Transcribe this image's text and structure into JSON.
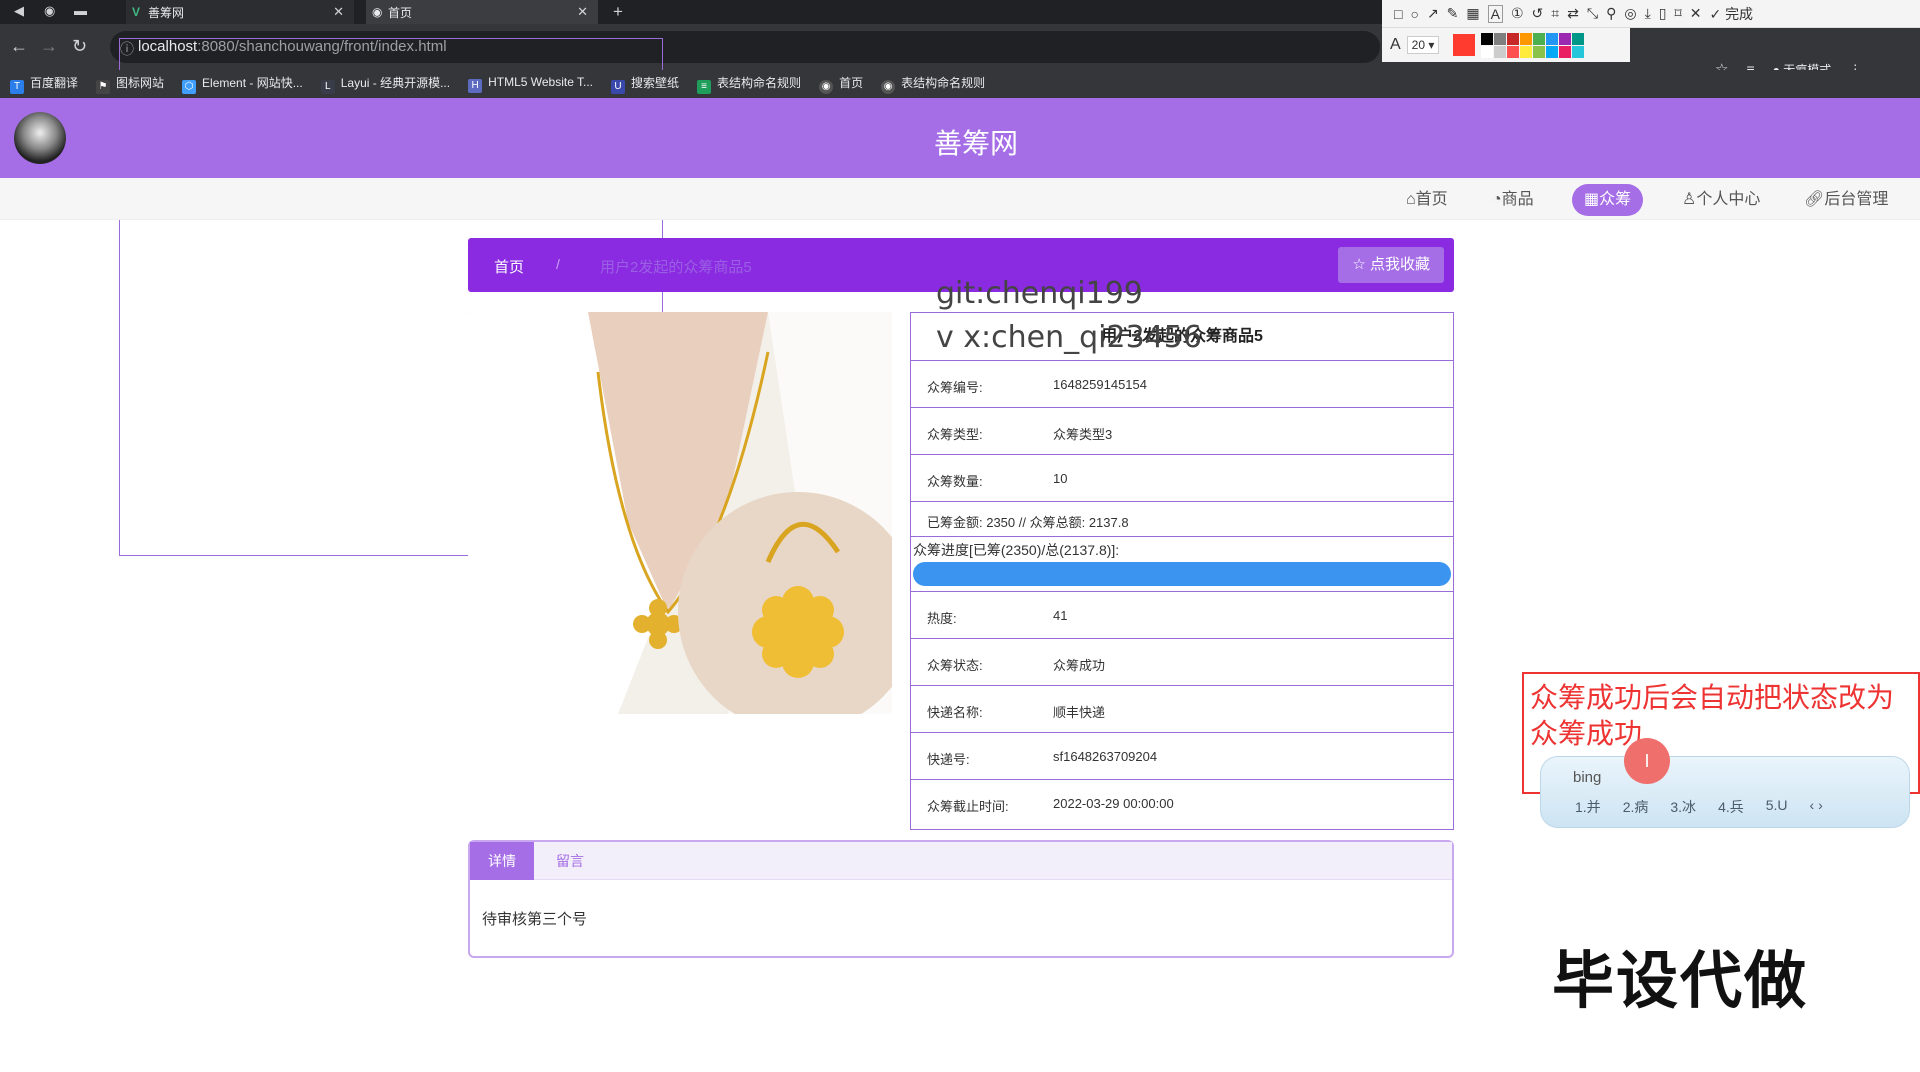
{
  "browser": {
    "tabs": [
      {
        "label": "善筹网"
      },
      {
        "label": "首页"
      }
    ],
    "url_host": "localhost",
    "url_path": ":8080/shanchouwang/front/index.html",
    "incognito_label": "无痕模式",
    "bookmarks": [
      "百度翻译",
      "图标网站",
      "Element - 网站快...",
      "Layui - 经典开源模...",
      "HTML5 Website T...",
      "搜索壁纸",
      "表结构命名规则",
      "首页",
      "表结构命名规则"
    ]
  },
  "annotation_toolbar": {
    "font_size": "20",
    "done_label": "完成",
    "colors": [
      "#ff3b30",
      "#000000",
      "#7f7f7f",
      "#c62828",
      "#ff9800",
      "#4caf50",
      "#2196f3",
      "#9c27b0",
      "#009688",
      "#ffffff",
      "#cccccc",
      "#ff4f4f",
      "#ffeb3b",
      "#8bc34a",
      "#03a9f4",
      "#e91e63",
      "#26c6da"
    ]
  },
  "site": {
    "title": "善筹网",
    "nav": [
      {
        "label": "首页"
      },
      {
        "label": "商品"
      },
      {
        "label": "众筹"
      },
      {
        "label": "个人中心"
      },
      {
        "label": "后台管理"
      }
    ],
    "active_nav": "众筹"
  },
  "breadcrumb": {
    "home": "首页",
    "separator": "/",
    "current": "用户2发起的众筹商品5",
    "favorite_label": "点我收藏"
  },
  "product": {
    "title": "用户2发起的众筹商品5",
    "fields": [
      {
        "key": "众筹编号:",
        "value": "1648259145154"
      },
      {
        "key": "众筹类型:",
        "value": "众筹类型3"
      },
      {
        "key": "众筹数量:",
        "value": "10"
      }
    ],
    "amount_line": "已筹金额: 2350 // 众筹总额: 2137.8",
    "progress_label": "众筹进度[已筹(2350)/总(2137.8)]:",
    "progress_percent": 100,
    "fields2": [
      {
        "key": "热度:",
        "value": "41"
      },
      {
        "key": "众筹状态:",
        "value": "众筹成功"
      },
      {
        "key": "快递名称:",
        "value": "顺丰快递"
      },
      {
        "key": "快递号:",
        "value": "sf1648263709204"
      },
      {
        "key": "众筹截止时间:",
        "value": "2022-03-29 00:00:00"
      }
    ]
  },
  "watermark": {
    "line1": "git:chenqi199",
    "line2": "v x:chen_qi23456",
    "big": "毕设代做"
  },
  "detail_tabs": {
    "tabs": [
      "详情",
      "留言"
    ],
    "content": "待审核第三个号"
  },
  "note": {
    "text": "众筹成功后会自动把状态改为众筹成功"
  },
  "ime": {
    "input": "bing",
    "candidates": [
      "1.并",
      "2.病",
      "3.冰",
      "4.兵",
      "5.U"
    ]
  }
}
